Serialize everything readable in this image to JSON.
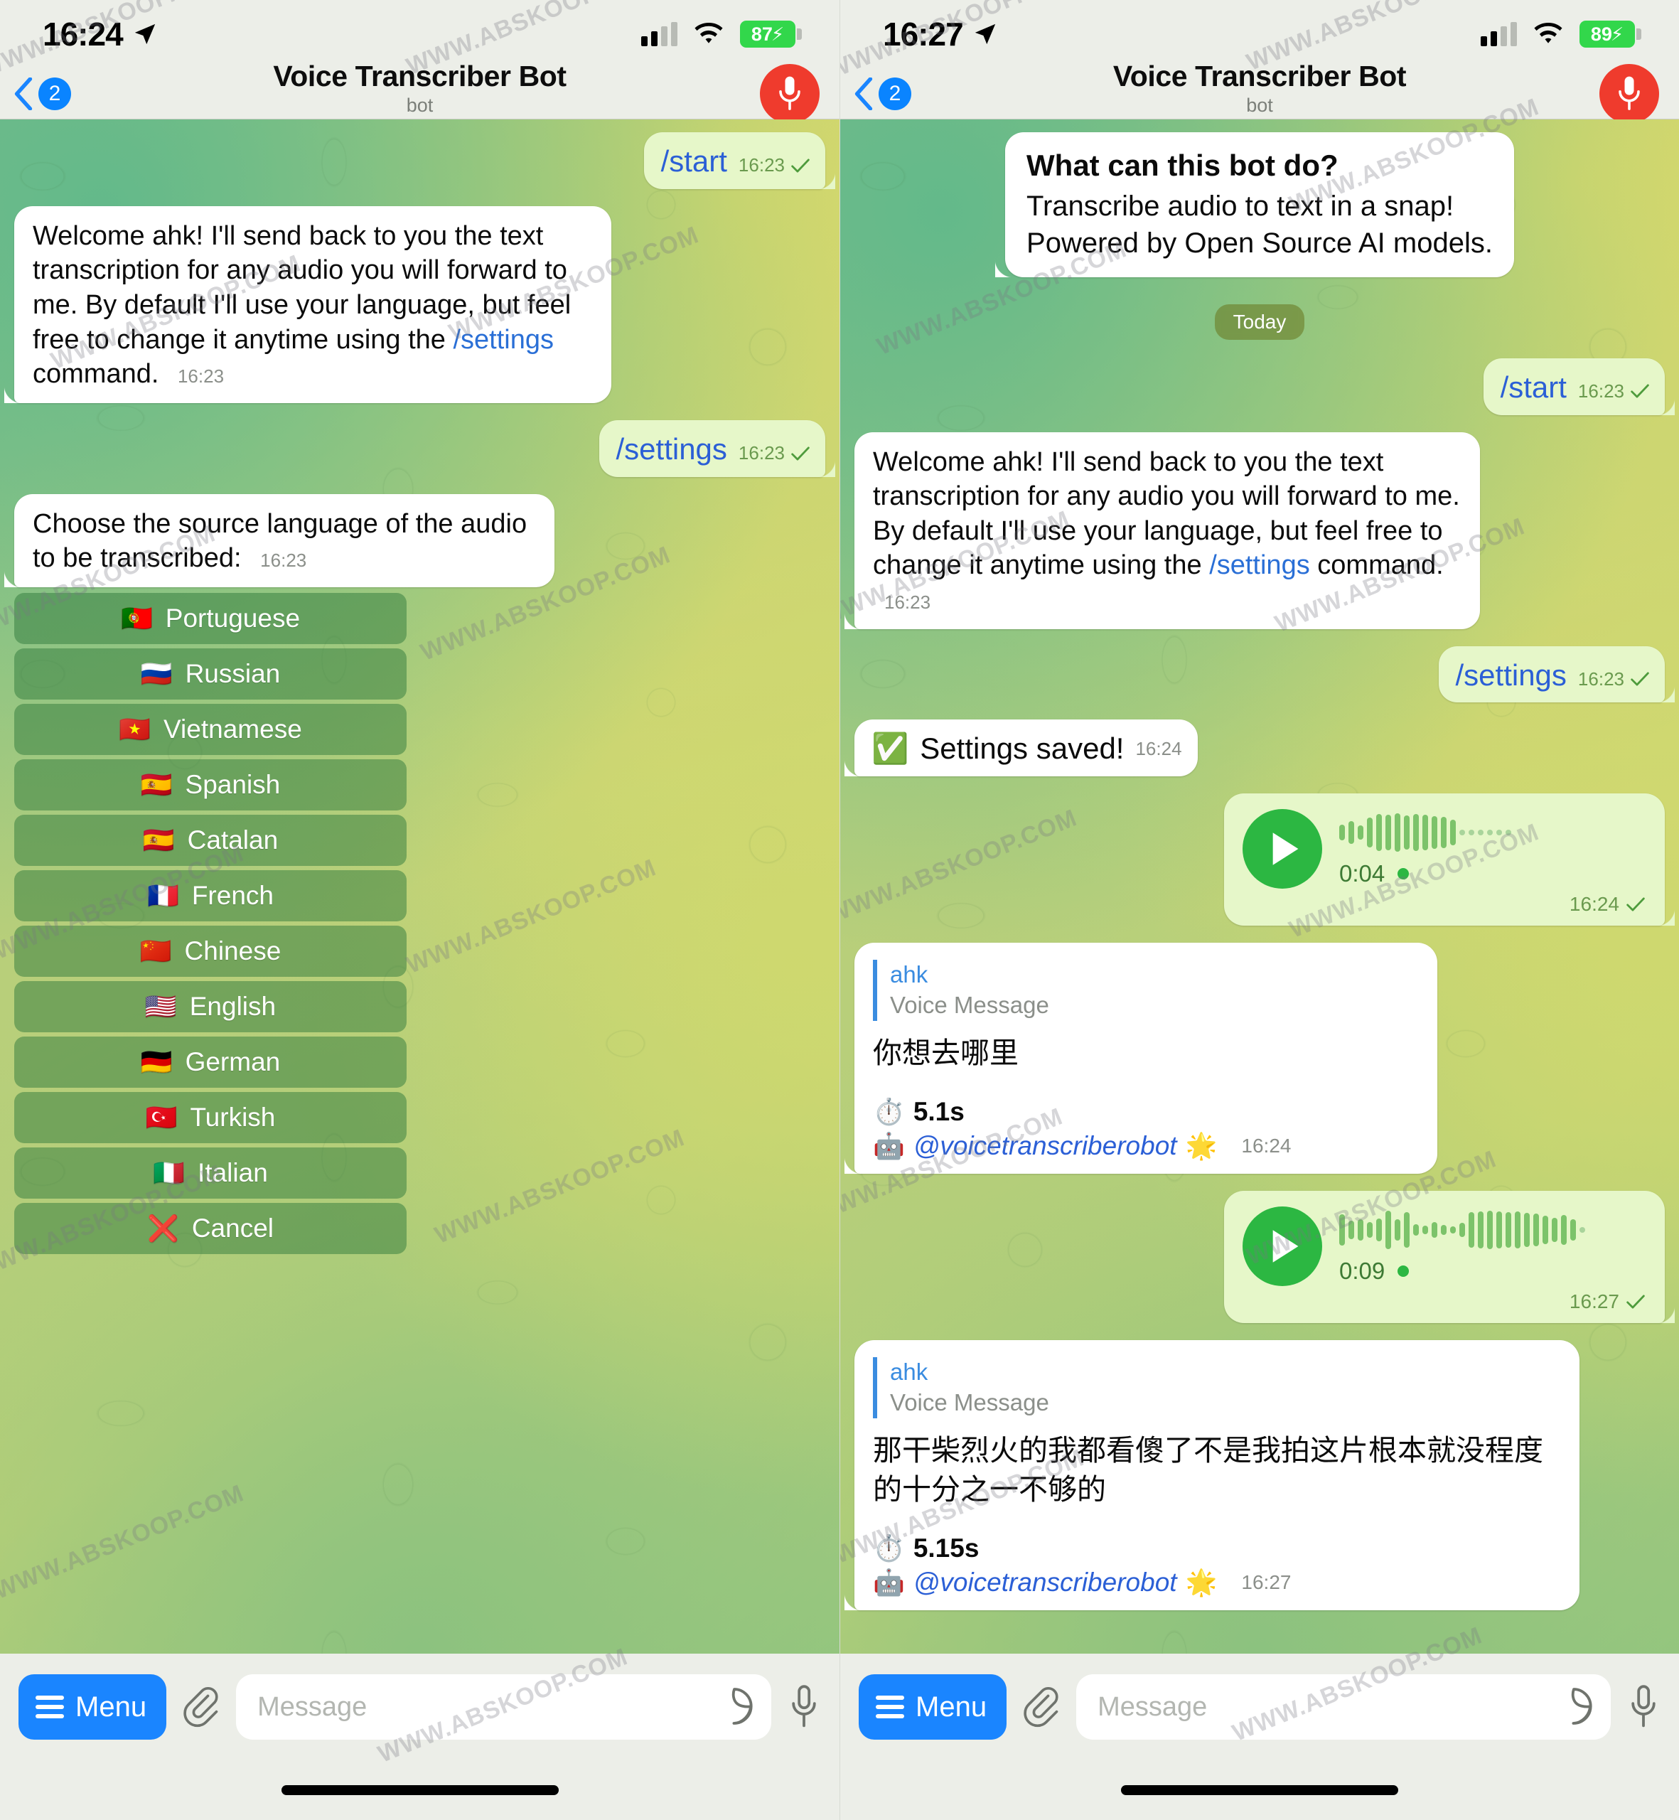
{
  "left": {
    "status": {
      "time": "16:24",
      "battery": "87",
      "battery_icon": "battery-charging-icon",
      "wifi_icon": "wifi-icon",
      "signal_icon": "cellular-signal-icon",
      "location_icon": "location-arrow-icon"
    },
    "nav": {
      "back_count": "2",
      "title": "Voice Transcriber Bot",
      "subtitle": "bot",
      "mic_icon": "microphone-record-icon"
    },
    "messages": [
      {
        "kind": "command_out",
        "text": "/start",
        "time": "16:23"
      },
      {
        "kind": "text_in",
        "text_before": "Welcome ahk! I'll send back to you the text transcription for any audio you will forward to me. By default I'll use your language, but feel free to change it anytime using the ",
        "command": "/settings",
        "text_after": " command.",
        "time": "16:23"
      },
      {
        "kind": "command_out",
        "text": "/settings",
        "time": "16:23"
      },
      {
        "kind": "text_in",
        "text_before": "Choose the source language of the audio to be transcribed:",
        "command": "",
        "text_after": "",
        "time": "16:23"
      }
    ],
    "keyboard": [
      {
        "flag": "🇵🇹",
        "label": "Portuguese"
      },
      {
        "flag": "🇷🇺",
        "label": "Russian"
      },
      {
        "flag": "🇻🇳",
        "label": "Vietnamese"
      },
      {
        "flag": "🇪🇸",
        "label": "Spanish"
      },
      {
        "flag": "🇪🇸",
        "label": "Catalan"
      },
      {
        "flag": "🇫🇷",
        "label": "French"
      },
      {
        "flag": "🇨🇳",
        "label": "Chinese"
      },
      {
        "flag": "🇺🇸",
        "label": "English"
      },
      {
        "flag": "🇩🇪",
        "label": "German"
      },
      {
        "flag": "🇹🇷",
        "label": "Turkish"
      },
      {
        "flag": "🇮🇹",
        "label": "Italian"
      },
      {
        "flag": "❌",
        "label": "Cancel"
      }
    ],
    "composer": {
      "menu_label": "Menu",
      "placeholder": "Message",
      "attach_icon": "paperclip-icon",
      "sticker_icon": "sticker-icon",
      "mic_icon": "microphone-icon"
    }
  },
  "right": {
    "status": {
      "time": "16:27",
      "battery": "89",
      "battery_icon": "battery-charging-icon",
      "wifi_icon": "wifi-icon",
      "signal_icon": "cellular-signal-icon",
      "location_icon": "location-arrow-icon"
    },
    "nav": {
      "back_count": "2",
      "title": "Voice Transcriber Bot",
      "subtitle": "bot",
      "mic_icon": "microphone-record-icon"
    },
    "intro": {
      "title": "What can this bot do?",
      "line1": "Transcribe audio to text in a snap!",
      "line2": "Powered by Open Source AI models."
    },
    "day_separator": "Today",
    "messages": [
      {
        "kind": "command_out",
        "text": "/start",
        "time": "16:23"
      },
      {
        "kind": "text_in",
        "text_before": "Welcome ahk! I'll send back to you the text transcription for any audio you will forward to me. By default I'll use your language, but feel free to change it anytime using the ",
        "command": "/settings",
        "text_after": " command.",
        "time": "16:23"
      },
      {
        "kind": "command_out",
        "text": "/settings",
        "time": "16:23"
      },
      {
        "kind": "status_in",
        "emoji": "✅",
        "text": "Settings saved!",
        "time": "16:24"
      }
    ],
    "voice1": {
      "duration": "0:04",
      "time": "16:24",
      "play_icon": "play-icon"
    },
    "transcript1": {
      "reply_name": "ahk",
      "reply_kind": "Voice Message",
      "text": "你想去哪里",
      "clock_emoji": "⏱️",
      "elapsed": "5.1s",
      "bot_emoji": "🤖",
      "handle": "@voicetranscriberobot",
      "star_emoji": "🌟",
      "time": "16:24"
    },
    "voice2": {
      "duration": "0:09",
      "time": "16:27",
      "play_icon": "play-icon"
    },
    "transcript2": {
      "reply_name": "ahk",
      "reply_kind": "Voice Message",
      "text": "那干柴烈火的我都看傻了不是我拍这片根本就没程度的十分之一不够的",
      "clock_emoji": "⏱️",
      "elapsed": "5.15s",
      "bot_emoji": "🤖",
      "handle": "@voicetranscriberobot",
      "star_emoji": "🌟",
      "time": "16:27"
    },
    "composer": {
      "menu_label": "Menu",
      "placeholder": "Message",
      "attach_icon": "paperclip-icon",
      "sticker_icon": "sticker-icon",
      "mic_icon": "microphone-icon"
    }
  },
  "watermark": {
    "text": "WWW.ABSKOOP.COM"
  },
  "colors": {
    "accent_blue": "#1a85ff",
    "out_bubble": "#e6f7c9",
    "in_bubble": "#ffffff",
    "play_green": "#2cb742",
    "record_red": "#ef3b2d",
    "battery_green": "#32d74b"
  }
}
